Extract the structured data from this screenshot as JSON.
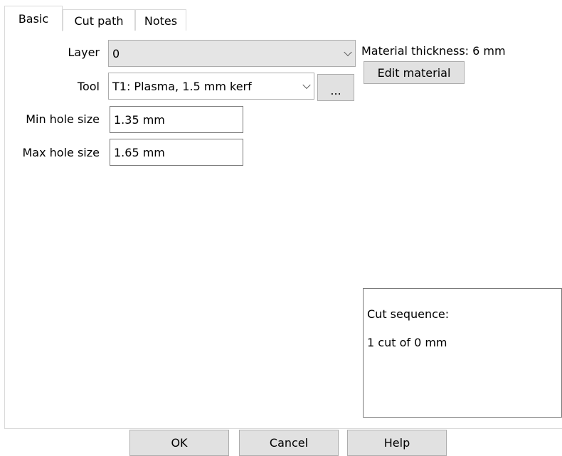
{
  "tabs": [
    {
      "label": "Basic",
      "active": true
    },
    {
      "label": "Cut path",
      "active": false
    },
    {
      "label": "Notes",
      "active": false
    }
  ],
  "form": {
    "layer_label": "Layer",
    "layer_value": "0",
    "tool_label": "Tool",
    "tool_value": "T1: Plasma, 1.5 mm kerf",
    "tool_more_button": "...",
    "min_hole_label": "Min hole size",
    "min_hole_value": "1.35 mm",
    "max_hole_label": "Max hole size",
    "max_hole_value": "1.65 mm"
  },
  "material": {
    "thickness_text": "Material thickness: 6 mm",
    "edit_button": "Edit material"
  },
  "cut_sequence": {
    "title": "Cut sequence:",
    "line": "1 cut of 0 mm"
  },
  "footer": {
    "ok": "OK",
    "cancel": "Cancel",
    "help": "Help"
  }
}
